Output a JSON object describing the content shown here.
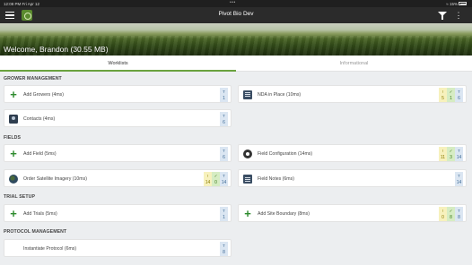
{
  "status_bar": {
    "time": "12:08 PM",
    "date": "Fri Apr 12",
    "battery": "15%"
  },
  "app": {
    "title": "Pivot Bio Dev",
    "welcome": "Welcome, Brandon (30.55 MB)"
  },
  "tabs": [
    {
      "label": "Worklists"
    },
    {
      "label": "Informational"
    }
  ],
  "sections": {
    "grower": "GROWER MANAGEMENT",
    "fields": "FIELDS",
    "trial": "TRIAL SETUP",
    "protocol": "PROTOCOL MANAGEMENT"
  },
  "badge_symbols": {
    "warn": "!",
    "ok": "✓",
    "total": "T"
  },
  "cards": {
    "add_growers": {
      "label": "Add Growers (4ms)",
      "total": "1",
      "icon": "plus-icon"
    },
    "nda_in_place": {
      "label": "NDA in Place (10ms)",
      "warn": "5",
      "ok": "1",
      "total": "6",
      "icon": "document-icon"
    },
    "contacts": {
      "label": "Contacts (4ms)",
      "total": "6",
      "icon": "contacts-icon"
    },
    "add_field": {
      "label": "Add Field (5ms)",
      "total": "6",
      "icon": "plus-icon"
    },
    "field_configuration": {
      "label": "Field Configuration (14ms)",
      "warn": "11",
      "ok": "3",
      "total": "14",
      "icon": "gear-icon"
    },
    "order_satellite": {
      "label": "Order Satellite Imagery (10ms)",
      "warn": "14",
      "ok": "0",
      "total": "14",
      "icon": "globe-icon"
    },
    "field_notes": {
      "label": "Field Notes (6ms)",
      "total": "14",
      "icon": "notes-icon"
    },
    "add_trials": {
      "label": "Add Trials (5ms)",
      "total": "1",
      "icon": "plus-icon"
    },
    "add_site_boundary": {
      "label": "Add Site Boundary (8ms)",
      "warn": "0",
      "ok": "8",
      "total": "8",
      "icon": "plus-icon"
    },
    "instantiate_protocol": {
      "label": "Instantiate Protocol (6ms)",
      "total": "8"
    }
  },
  "colors": {
    "accent": "#6aa23f",
    "plus": "#2e8b2e",
    "warn_bg": "#f7f1bd",
    "ok_bg": "#d6ecc3",
    "total_bg": "#dbe6f2"
  }
}
